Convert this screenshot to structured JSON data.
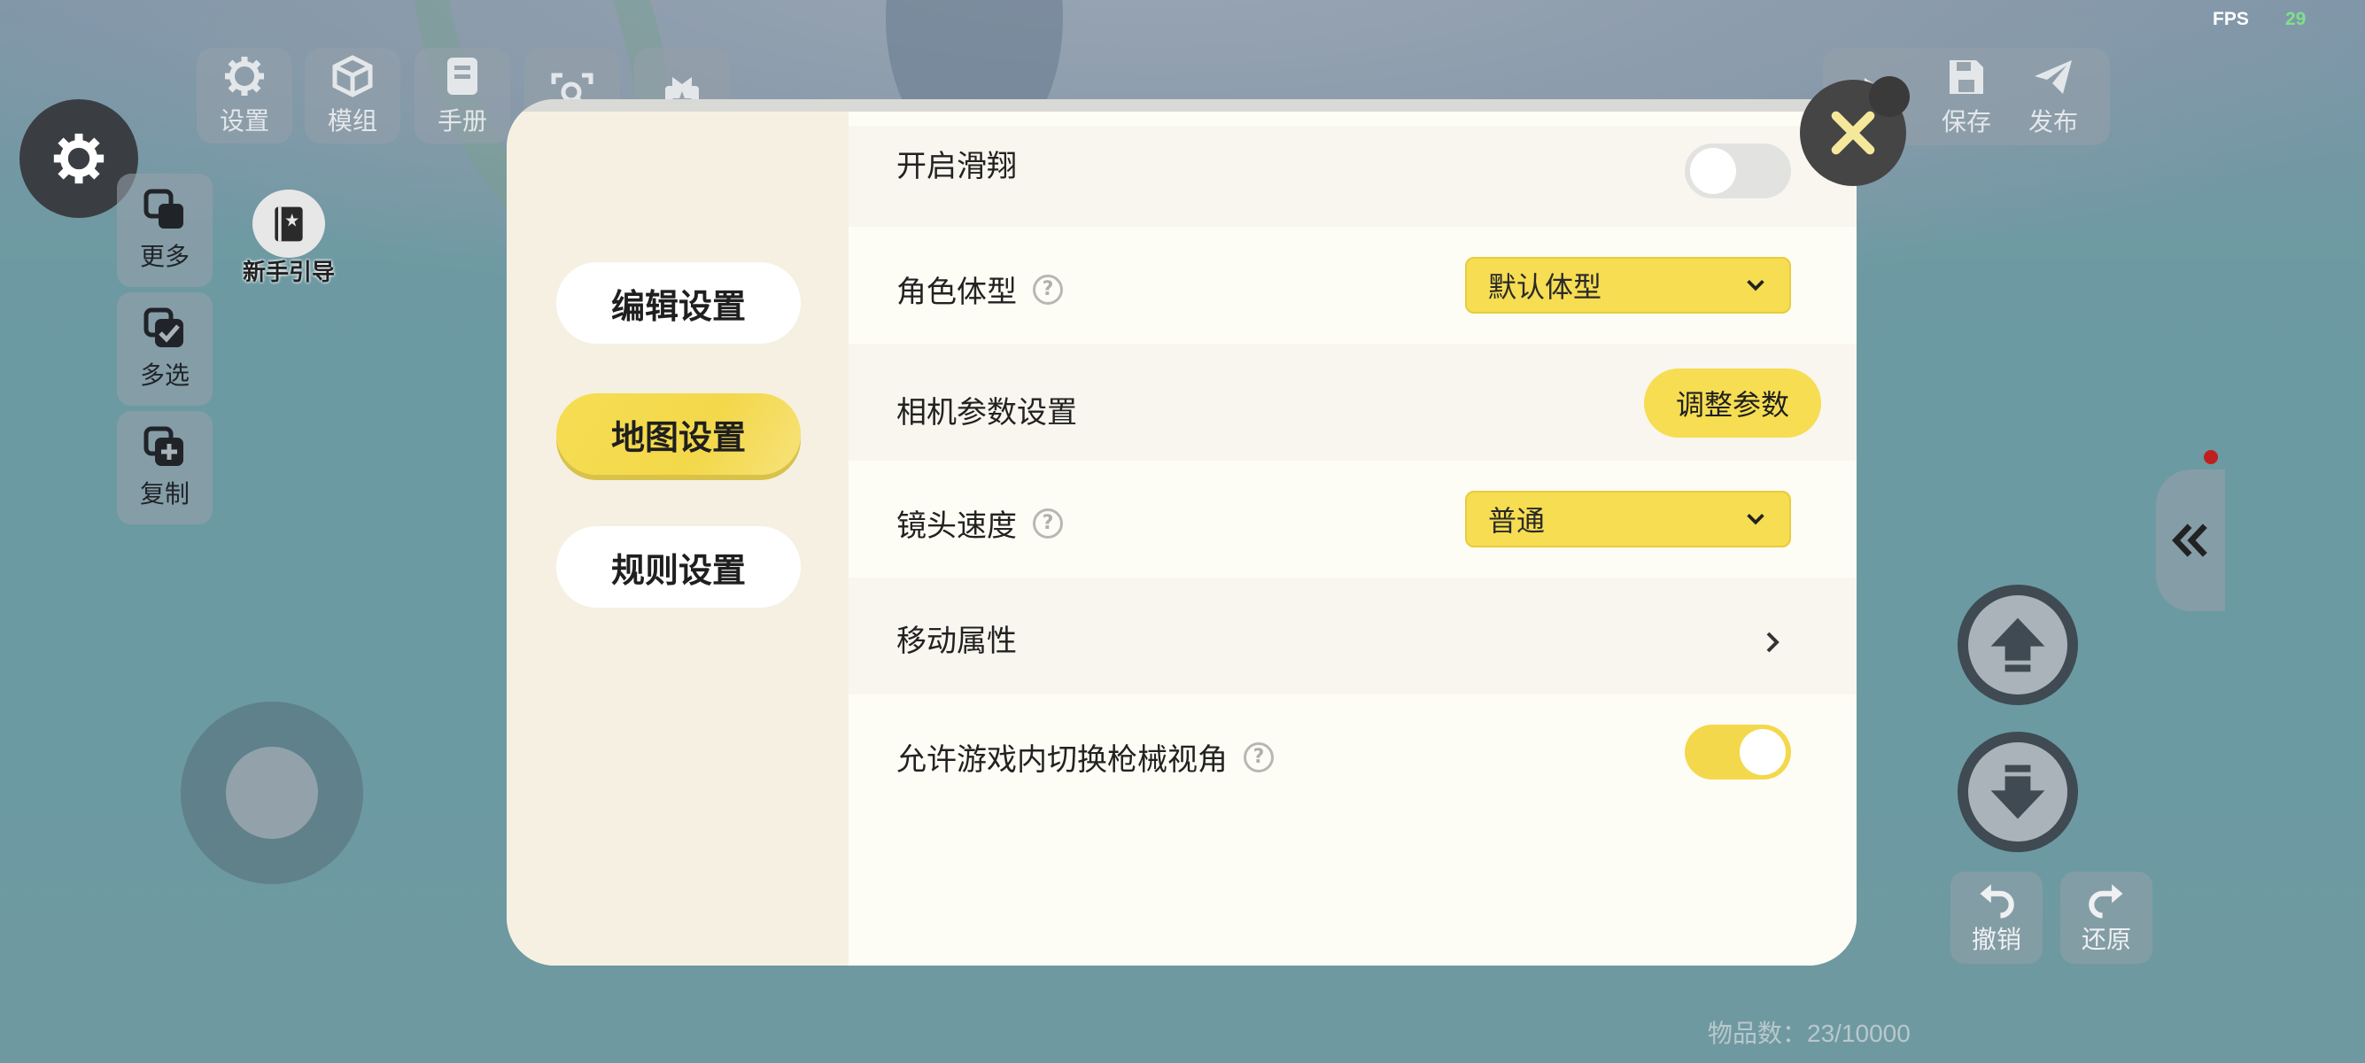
{
  "hud": {
    "fps_label": "FPS",
    "fps_value": "29",
    "top_buttons": [
      {
        "label": "设置",
        "icon": "gear-icon"
      },
      {
        "label": "模组",
        "icon": "cube-icon"
      },
      {
        "label": "手册",
        "icon": "book-icon"
      },
      {
        "label": "",
        "icon": "search-frame-icon"
      },
      {
        "label": "",
        "icon": "gift-icon"
      }
    ],
    "right_toolbar": [
      {
        "label": "",
        "icon": "play-icon"
      },
      {
        "label": "保存",
        "icon": "save-icon"
      },
      {
        "label": "发布",
        "icon": "send-icon"
      }
    ],
    "side_buttons": [
      {
        "label": "更多",
        "icon": "layers-icon"
      },
      {
        "label": "多选",
        "icon": "multi-check-icon"
      },
      {
        "label": "复制",
        "icon": "copy-plus-icon"
      }
    ],
    "guide_label": "新手引导",
    "undo_label": "撤销",
    "redo_label": "还原",
    "item_count": "物品数：23/10000"
  },
  "modal": {
    "nav": [
      {
        "label": "编辑设置",
        "active": false
      },
      {
        "label": "地图设置",
        "active": true
      },
      {
        "label": "规则设置",
        "active": false
      }
    ],
    "rows": {
      "glide": {
        "label": "开启滑翔",
        "toggle": "off"
      },
      "body_type": {
        "label": "角色体型",
        "value": "默认体型"
      },
      "camera": {
        "label": "相机参数设置",
        "button": "调整参数"
      },
      "lens_speed": {
        "label": "镜头速度",
        "value": "普通"
      },
      "move": {
        "label": "移动属性"
      },
      "gun_view": {
        "label": "允许游戏内切换枪械视角",
        "toggle": "on"
      }
    }
  },
  "colors": {
    "accent_yellow": "#f6dd52",
    "modal_bg": "#fefdf5",
    "sidebar_bg": "#f6f0e2"
  }
}
